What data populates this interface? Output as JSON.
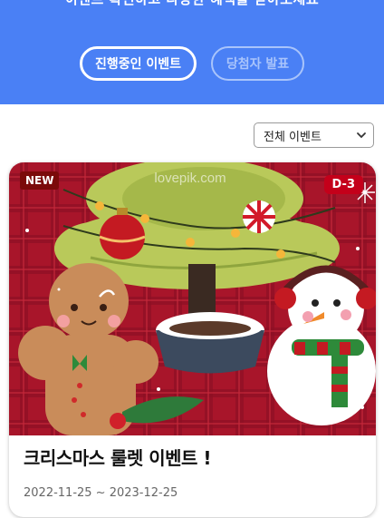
{
  "hero": {
    "partial_text": "이벤트 확인하고 다양한 혜택을 받아보세요",
    "tabs": [
      {
        "label": "진행중인 이벤트",
        "active": true
      },
      {
        "label": "당첨자 발표",
        "active": false
      }
    ],
    "background_color": "#4a80f5"
  },
  "filter": {
    "selected": "전체 이벤트"
  },
  "events": [
    {
      "badge": "NEW",
      "dday": "D-3",
      "watermark": "lovepik.com",
      "title": "크리스마스 룰렛 이벤트 !",
      "date_range": "2022-11-25 ~ 2023-12-25"
    }
  ]
}
